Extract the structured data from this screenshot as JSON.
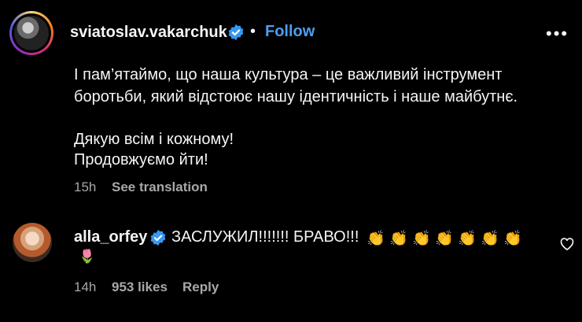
{
  "post": {
    "username": "sviatoslav.vakarchuk",
    "separator": "•",
    "follow_label": "Follow",
    "more_label": "•••",
    "lines": [
      "І пам’ятаймо, що наша культура – це важливий інструмент",
      "боротьби, який відстоює нашу ідентичність і наше майбутнє.",
      "Дякую всім і кожному!",
      "Продовжуємо йти!"
    ],
    "time": "15h",
    "see_translation": "See translation"
  },
  "comment": {
    "username": "alla_orfey",
    "text": "ЗАСЛУЖИЛ!!!!!!! БРАВО!!!",
    "emoji_clap": "👏",
    "emoji_tulip": "🌷",
    "time": "14h",
    "likes": "953 likes",
    "reply": "Reply"
  },
  "colors": {
    "background": "#000000",
    "text": "#f5f5f5",
    "secondary": "#a8a8a8",
    "link": "#4c9ff0",
    "verified": "#3897f0"
  }
}
